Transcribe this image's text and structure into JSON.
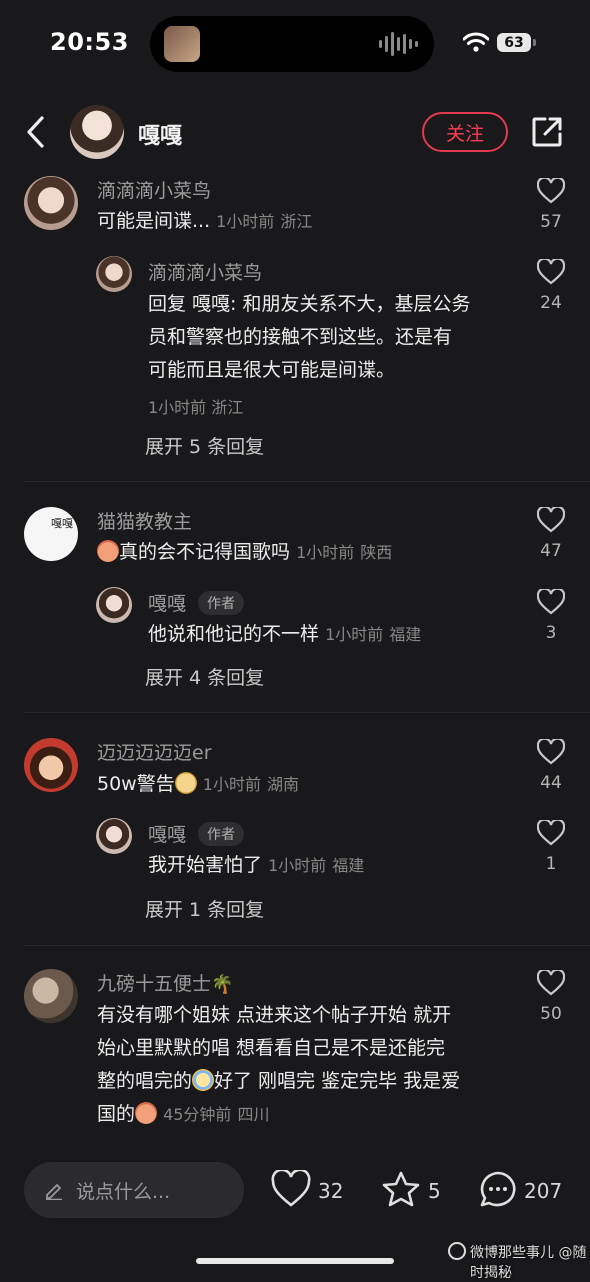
{
  "status_bar": {
    "time": "20:53",
    "battery": "63"
  },
  "header": {
    "name": "嘎嘎",
    "follow_label": "关注"
  },
  "comments": [
    {
      "user": "滴滴滴小菜鸟",
      "text": "可能是间谍...",
      "time": "1小时前",
      "location": "浙江",
      "likes": "57",
      "replies": [
        {
          "user": "滴滴滴小菜鸟",
          "text_lines": [
            "回复 嘎嘎: 和朋友关系不大，基层公务",
            "员和警察也的接触不到这些。还是有",
            "可能而且是很大可能是间谍。"
          ],
          "time": "1小时前",
          "location": "浙江",
          "likes": "24"
        }
      ],
      "expand": "展开 5 条回复"
    },
    {
      "user": "猫猫教教主",
      "avatar_text": "嘎嘎",
      "text": "真的会不记得国歌吗",
      "time": "1小时前",
      "location": "陕西",
      "likes": "47",
      "replies": [
        {
          "user": "嘎嘎",
          "badge": "作者",
          "text": "他说和他记的不一样",
          "time": "1小时前",
          "location": "福建",
          "likes": "3"
        }
      ],
      "expand": "展开 4 条回复"
    },
    {
      "user": "迈迈迈迈迈er",
      "text": "50w警告",
      "time": "1小时前",
      "location": "湖南",
      "likes": "44",
      "replies": [
        {
          "user": "嘎嘎",
          "badge": "作者",
          "text": "我开始害怕了",
          "time": "1小时前",
          "location": "福建",
          "likes": "1"
        }
      ],
      "expand": "展开 1 条回复"
    },
    {
      "user": "九磅十五便士",
      "text_lines": [
        "有没有哪个姐妹 点进来这个帖子开始 就开",
        "始心里默默的唱 想看看自己是不是还能完",
        "整的唱完的",
        "好了 刚唱完 鉴定完毕 我是爱",
        "国的"
      ],
      "time": "45分钟前",
      "location": "四川",
      "likes": "50"
    }
  ],
  "bottom_bar": {
    "input_placeholder": "说点什么...",
    "likes": "32",
    "stars": "5",
    "comments": "207"
  },
  "watermark": "微博那些事儿 @随时揭秘"
}
